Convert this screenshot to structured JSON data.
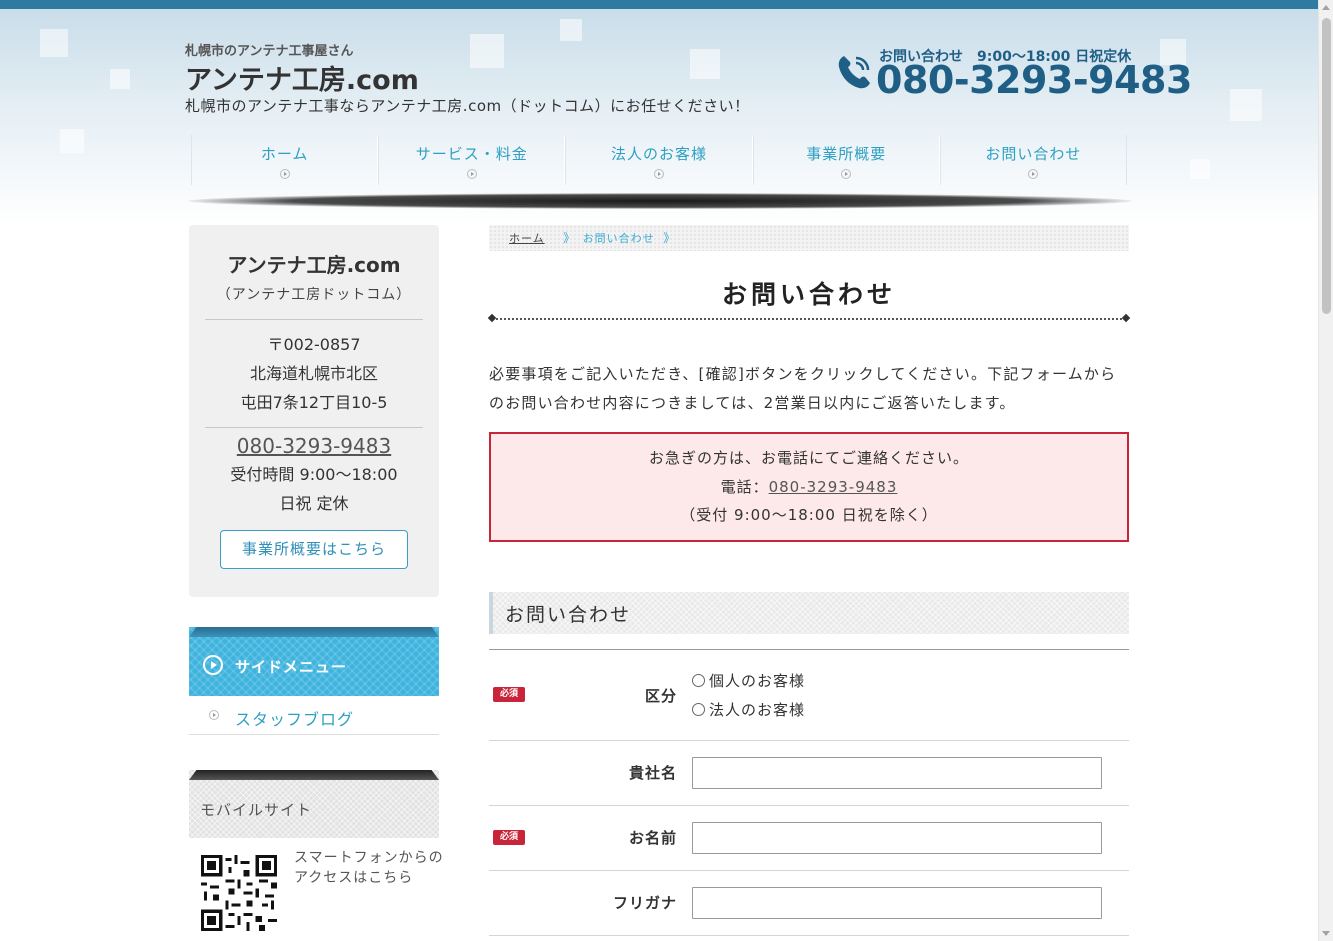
{
  "header": {
    "tagline": "札幌市のアンテナ工事屋さん",
    "site_title": "アンテナ工房.com",
    "description": "札幌市のアンテナ工事ならアンテナ工房.com（ドットコム）にお任せください！",
    "phone_hours": "お問い合わせ　9:00～18:00 日祝定休",
    "phone_number": "080-3293-9483",
    "phone_icon": "phone-icon"
  },
  "nav": {
    "items": [
      {
        "label": "ホーム"
      },
      {
        "label": "サービス・料金"
      },
      {
        "label": "法人のお客様"
      },
      {
        "label": "事業所概要"
      },
      {
        "label": "お問い合わせ"
      }
    ]
  },
  "sidebar": {
    "info": {
      "name": "アンテナ工房.com",
      "reading": "（アンテナ工房ドットコム）",
      "postal": "〒002-0857",
      "address1": "北海道札幌市北区",
      "address2": "屯田7条12丁目10-5",
      "tel": "080-3293-9483",
      "hours": "受付時間 9:00～18:00",
      "holiday": "日祝 定休",
      "button": "事業所概要はこちら"
    },
    "menu": {
      "title": "サイドメニュー",
      "items": [
        {
          "label": "スタッフブログ"
        }
      ]
    },
    "mobile": {
      "title": "モバイルサイト",
      "text": "スマートフォンからのアクセスはこちら"
    }
  },
  "main": {
    "breadcrumb": {
      "home": "ホーム",
      "sep": "》",
      "current": "お問い合わせ"
    },
    "title": "お問い合わせ",
    "intro": "必要事項をご記入いただき、[確認]ボタンをクリックしてください。下記フォームからのお問い合わせ内容につきましては、2営業日以内にご返答いたします。",
    "notice": {
      "line1": "お急ぎの方は、お電話にてご連絡ください。",
      "tel_prefix": "電話：",
      "tel": "080-3293-9483",
      "line3": "（受付 9:00～18:00 日祝を除く）"
    },
    "form": {
      "heading": "お問い合わせ",
      "required_badge": "必須",
      "fields": {
        "category": {
          "label": "区分",
          "options": [
            "個人のお客様",
            "法人のお客様"
          ]
        },
        "company": {
          "label": "貴社名",
          "value": ""
        },
        "name": {
          "label": "お名前",
          "value": ""
        },
        "furigana": {
          "label": "フリガナ",
          "value": ""
        }
      }
    }
  },
  "colors": {
    "accent": "#2ea0c3",
    "brand_blue": "#1f5f86",
    "required_red": "#c8243a"
  }
}
